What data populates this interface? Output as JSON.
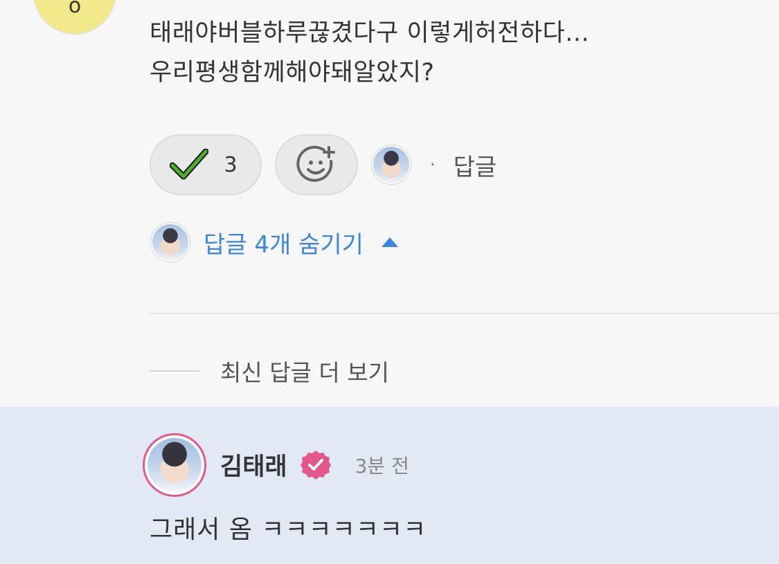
{
  "comment": {
    "author_initial": "o",
    "line1": "태래야버블하루끊겼다구 이렇게허전하다...",
    "line2": "우리평생함께해야돼알았지?"
  },
  "actions": {
    "reaction_icon": "green-check-icon",
    "reaction_count": "3",
    "add_reaction_icon": "smiley-plus-icon",
    "dot": "·",
    "reply_label": "답글"
  },
  "replies_toggle": {
    "label": "답글 4개 숨기기",
    "icon": "caret-up-icon"
  },
  "more_latest": {
    "label": "최신 답글 더 보기"
  },
  "reply": {
    "author": "김태래",
    "verified_icon": "verified-badge-icon",
    "time": "3분 전",
    "text": "그래서 옴 ㅋㅋㅋㅋㅋㅋㅋ"
  },
  "colors": {
    "link_blue": "#3a86e0",
    "verified_pink": "#e4578a",
    "highlight_bg": "#e1eaf4",
    "check_green": "#4caf2a"
  }
}
